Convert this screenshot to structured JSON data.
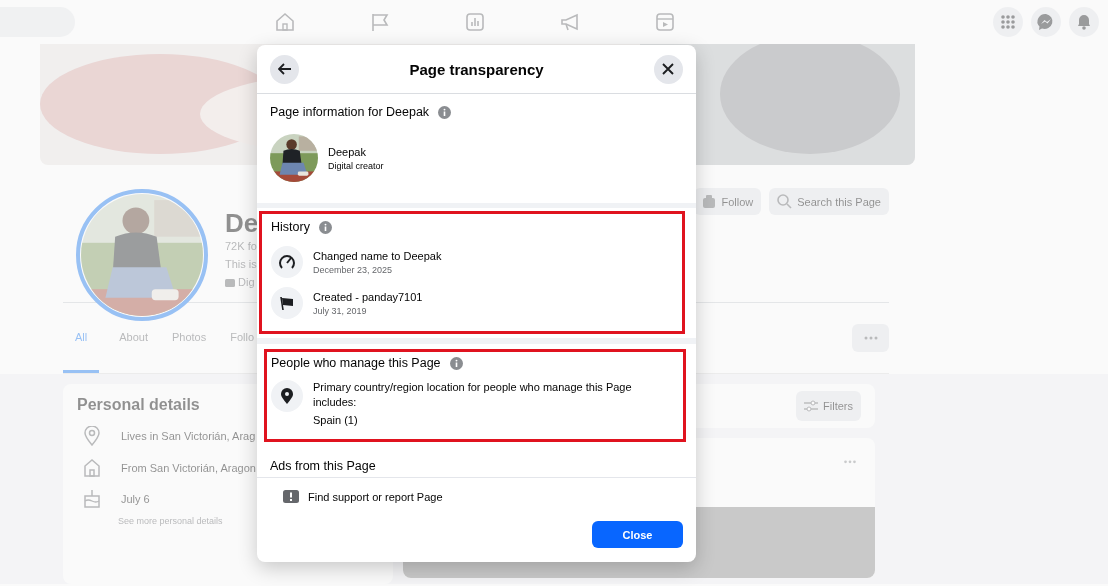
{
  "background_page": {
    "profile_name": "De",
    "followers": "72K fo",
    "intro": "This is",
    "category": "Dig",
    "actions": [
      {
        "kind": "follow",
        "label": "Follow"
      },
      {
        "kind": "search",
        "label": "Search this Page"
      }
    ],
    "tabs": [
      {
        "label": "All",
        "selected": true
      },
      {
        "label": "About",
        "selected": false
      },
      {
        "label": "Photos",
        "selected": false
      },
      {
        "label": "Follo",
        "selected": false
      }
    ],
    "personal_details": {
      "title": "Personal details",
      "items": [
        {
          "kind": "location",
          "text": "Lives in San Victorián, Arag"
        },
        {
          "kind": "home",
          "text": "From San Victorián, Aragon"
        },
        {
          "kind": "birthday",
          "text": "July 6"
        }
      ],
      "more_link": "See more personal details"
    },
    "filters_button": "Filters"
  },
  "dialog": {
    "title": "Page transparency",
    "page_info": {
      "heading": "Page information for Deepak",
      "name": "Deepak",
      "category": "Digital creator"
    },
    "history": {
      "heading": "History",
      "highlighted": true,
      "items": [
        {
          "kind": "name_change",
          "text": "Changed name to Deepak",
          "date": "December 23, 2025"
        },
        {
          "kind": "created",
          "text": "Created - panday7101",
          "date": "July 31, 2019"
        }
      ]
    },
    "managers": {
      "heading": "People who manage this Page",
      "highlighted": true,
      "text": "Primary country/region location for people who manage this Page includes:",
      "value": "Spain (1)"
    },
    "ads_heading": "Ads from this Page",
    "report_link": "Find support or report Page",
    "close_button": "Close"
  }
}
